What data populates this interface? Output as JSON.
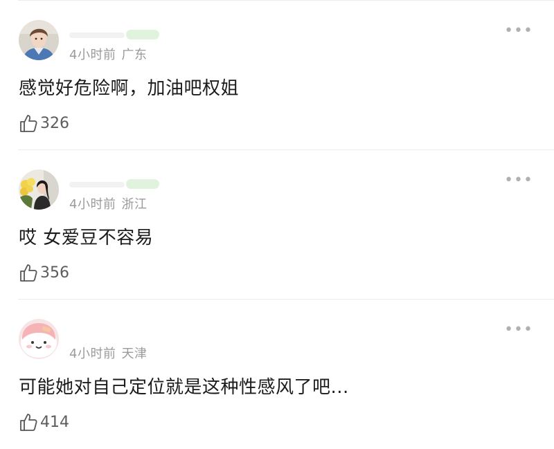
{
  "comments": [
    {
      "time": "4小时前",
      "region": "广东",
      "text": "感觉好危险啊，加油吧权姐",
      "likes": "326",
      "avatar": "person-blue-shirt-avatar",
      "more": "•••"
    },
    {
      "time": "4小时前",
      "region": "浙江",
      "text": "哎 女爱豆不容易",
      "likes": "356",
      "avatar": "woman-with-flowers-avatar",
      "more": "•••"
    },
    {
      "time": "4小时前",
      "region": "天津",
      "text": "可能她对自己定位就是这种性感风了吧...",
      "likes": "414",
      "avatar": "pink-cartoon-avatar",
      "more": "•••"
    }
  ],
  "colors": {
    "meta_gray": "#9a9a9a",
    "divider": "#ececec",
    "text": "#1b1b1b",
    "name_blur_green": "#dff3dd"
  }
}
